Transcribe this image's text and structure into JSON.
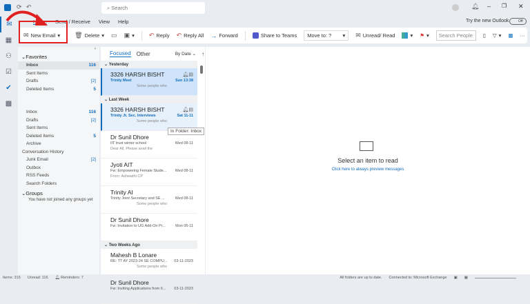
{
  "titlebar": {
    "search_placeholder": "Search",
    "try_new": "Try the new Outlook",
    "toggle": "Off"
  },
  "menu": [
    "Home",
    "Send / Receive",
    "View",
    "Help"
  ],
  "ribbon": {
    "new_email": "New Email",
    "delete": "Delete",
    "reply": "Reply",
    "reply_all": "Reply All",
    "forward": "Forward",
    "share_teams": "Share to Teams",
    "move_to": "Move to: ?",
    "unread_read": "Unread/ Read",
    "search_people": "Search People"
  },
  "favorites": {
    "title": "Favorites",
    "items": [
      {
        "label": "Inbox",
        "count": "116"
      },
      {
        "label": "Sent Items",
        "count": ""
      },
      {
        "label": "Drafts",
        "count": "[2]"
      },
      {
        "label": "Deleted Items",
        "count": "5"
      }
    ]
  },
  "folders": [
    {
      "label": "Inbox",
      "count": "116"
    },
    {
      "label": "Drafts",
      "count": "[2]"
    },
    {
      "label": "Sent Items",
      "count": ""
    },
    {
      "label": "Deleted Items",
      "count": "5"
    },
    {
      "label": "Archive",
      "count": ""
    },
    {
      "label": "Conversation History",
      "count": ""
    },
    {
      "label": "Junk Email",
      "count": "[2]"
    },
    {
      "label": "Outbox",
      "count": ""
    },
    {
      "label": "RSS Feeds",
      "count": ""
    },
    {
      "label": "Search Folders",
      "count": ""
    }
  ],
  "groups": {
    "title": "Groups",
    "empty": "You have not joined any groups yet"
  },
  "list": {
    "tab_focused": "Focused",
    "tab_other": "Other",
    "sort": "By Date",
    "groups": [
      {
        "title": "Yesterday",
        "messages": [
          {
            "from": "3326   HARSH BISHT",
            "subject": "Trinity Meet",
            "date": "Sun 13:38",
            "preview": "Some people who",
            "style": "sel"
          }
        ]
      },
      {
        "title": "Last Week",
        "messages": [
          {
            "from": "3326   HARSH BISHT",
            "subject": "Trinity Jt. Sec. Interviews",
            "date": "Sat 11-11",
            "preview": "Some people who",
            "style": "sel2"
          },
          {
            "from": "Dr Sunil Dhore",
            "subject": "IIT trust winter school",
            "date": "Wed 08-11",
            "preview": "Dear All,  Please avail the",
            "style": ""
          },
          {
            "from": "Jyoti AIT",
            "subject": "Fw: Empowering Female Stude...",
            "date": "Wed 08-11",
            "preview": "From: Ashwathi CP",
            "style": ""
          },
          {
            "from": "Trinity AI",
            "subject": "Trinity Joint Secretary and SE ...",
            "date": "Wed 08-11",
            "preview": "Some people who",
            "style": ""
          },
          {
            "from": "Dr Sunil Dhore",
            "subject": "Fw: Invitation to UG Add-On Pr...",
            "date": "Mon 06-11",
            "preview": "",
            "style": ""
          }
        ]
      },
      {
        "title": "Two Weeks Ago",
        "messages": [
          {
            "from": "Mahesh B Lonare",
            "subject": "RE: TT AY 2023-24 SE COMPU...",
            "date": "03-11-2023",
            "preview": "Some people who",
            "style": ""
          },
          {
            "from": "Dr Sunil Dhore",
            "subject": "Fw: Inviting Applications from II...",
            "date": "03-11-2023",
            "preview": "",
            "style": ""
          }
        ]
      }
    ]
  },
  "tooltip": "In Folder: Inbox",
  "reading": {
    "title": "Select an item to read",
    "link": "Click here to always preview messages"
  },
  "status": {
    "items": "Items: 315",
    "unread": "Unread: 116",
    "reminders": "Reminders: 7",
    "sync": "All folders are up to date.",
    "connected": "Connected to: Microsoft Exchange"
  },
  "colors": {
    "accent": "#0f6cbd",
    "highlight": "#e02020"
  }
}
